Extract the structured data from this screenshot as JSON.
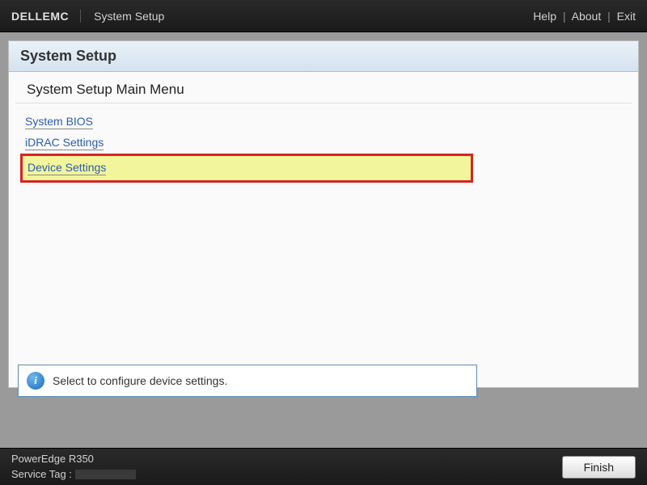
{
  "header": {
    "logo": "DELLEMC",
    "app_title": "System Setup",
    "help": "Help",
    "about": "About",
    "exit": "Exit"
  },
  "panel": {
    "title": "System Setup",
    "subtitle": "System Setup Main Menu"
  },
  "menu": {
    "items": [
      {
        "label": "System BIOS"
      },
      {
        "label": "iDRAC Settings"
      },
      {
        "label": "Device Settings"
      }
    ]
  },
  "info": {
    "message": "Select to configure device settings."
  },
  "footer": {
    "model": "PowerEdge R350",
    "service_tag_label": "Service Tag :",
    "finish": "Finish"
  }
}
